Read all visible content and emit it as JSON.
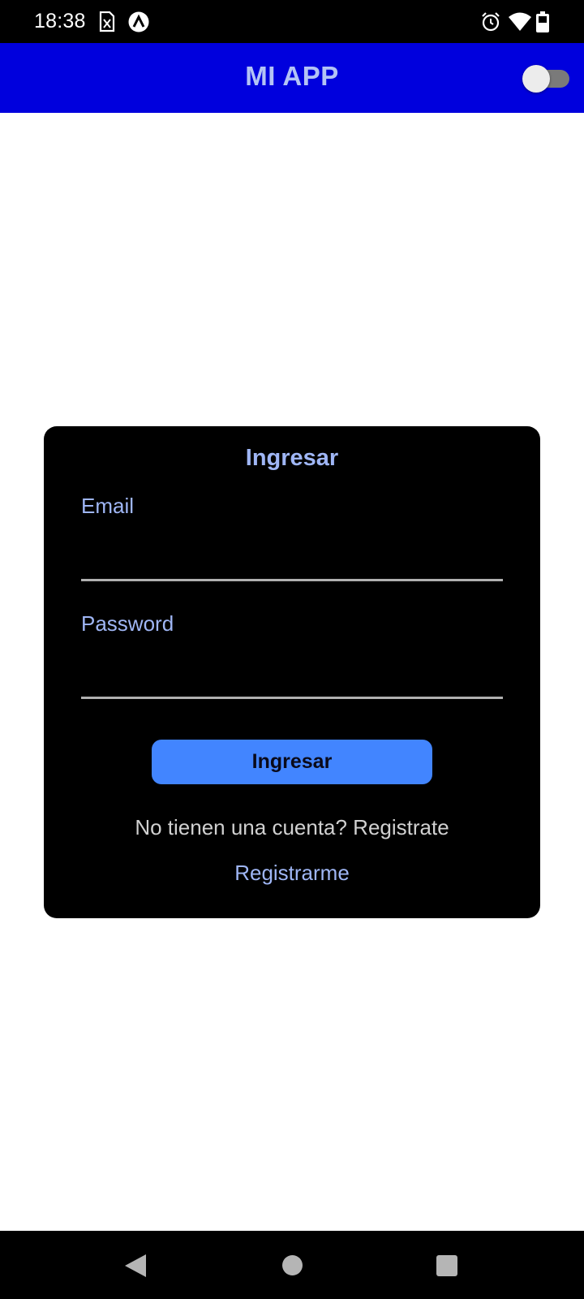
{
  "status_bar": {
    "time": "18:38",
    "icons": [
      "sim-card-icon",
      "app-notification-icon",
      "alarm-icon",
      "wifi-icon",
      "battery-icon"
    ]
  },
  "app_bar": {
    "title": "MI APP",
    "toggle_on": false,
    "background_color": "#0000dd"
  },
  "login_card": {
    "title": "Ingresar",
    "email_label": "Email",
    "email_value": "",
    "password_label": "Password",
    "password_value": "",
    "submit_label": "Ingresar",
    "no_account_text": "No tienen una cuenta? Registrate",
    "register_link": "Registrarme",
    "accent_color": "#4285ff"
  },
  "nav_bar": {
    "icons": [
      "back-icon",
      "home-icon",
      "recents-icon"
    ]
  }
}
